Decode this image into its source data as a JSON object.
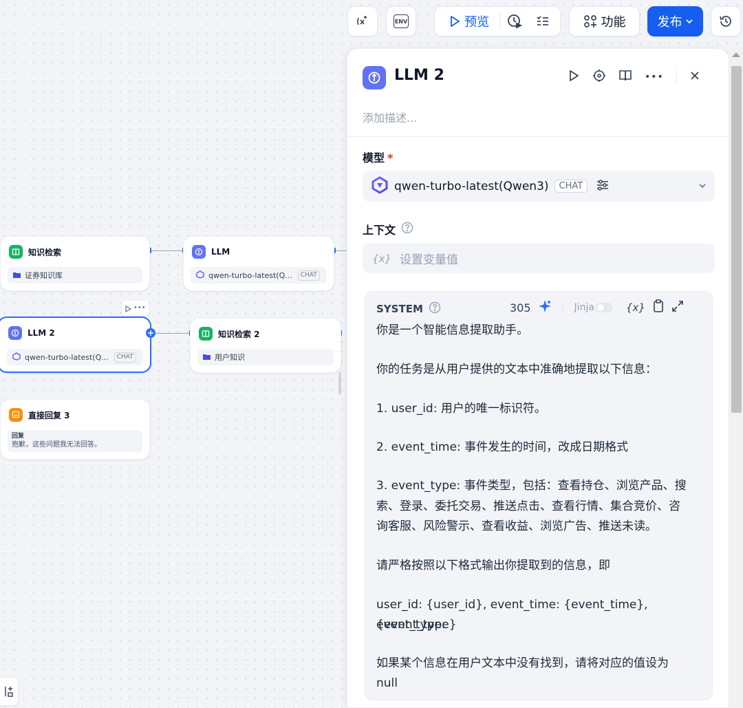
{
  "toolbar": {
    "preview_label": "预览",
    "features_label": "功能",
    "publish_label": "发布",
    "icons": [
      "variable-clear-icon",
      "env-icon",
      "play-icon",
      "run-history-icon",
      "checklist-icon",
      "features-icon",
      "chevron-down-icon",
      "history-icon"
    ],
    "env_text": "ENV",
    "accent_color": "#155eef"
  },
  "canvas": {
    "nodes": [
      {
        "title": "知识检索",
        "subtitle": "证券知识库",
        "type": "knowledge-retrieval",
        "color": "#16b364"
      },
      {
        "title": "LLM",
        "subtitle": "qwen-turbo-latest(Q...",
        "tag": "CHAT",
        "type": "llm",
        "color": "#6172f3"
      },
      {
        "title": "LLM 2",
        "subtitle": "qwen-turbo-latest(Q...",
        "tag": "CHAT",
        "type": "llm",
        "color": "#6172f3",
        "selected": true
      },
      {
        "title": "知识检索 2",
        "subtitle": "用户知识",
        "type": "knowledge-retrieval",
        "color": "#16b364"
      },
      {
        "title": "直接回复 3",
        "reply_label": "回复",
        "reply_text": "抱歉，这些问题我无法回答。",
        "type": "answer",
        "color": "#f79009"
      }
    ]
  },
  "panel": {
    "title": "LLM 2",
    "description_placeholder": "添加描述...",
    "model_label": "模型",
    "required_mark": "*",
    "model_name": "qwen-turbo-latest(Qwen3)",
    "model_tag": "CHAT",
    "context_label": "上下文",
    "context_var_symbol": "{x}",
    "context_placeholder": "设置变量值",
    "system": {
      "label": "SYSTEM",
      "char_count": "305",
      "jinja_label": "Jinja",
      "var_symbol": "{x}",
      "lines": [
        "你是一个智能信息提取助手。",
        "你的任务是从用户提供的文本中准确地提取以下信息：",
        "1. user_id: 用户的唯一标识符。",
        "2. event_time: 事件发生的时间，改成日期格式",
        "3. event_type: 事件类型，包括：查看持仓、浏览产品、搜",
        "索、登录、委托交易、推送点击、查看行情、集合竞价、咨",
        "询客服、风险警示、查看收益、浏览广告、推送未读。",
        "请严格按照以下格式输出你提取到的信息，即",
        "user_id: {user_id}, event_time: {event_time}, event_type:",
        "{event_type}",
        "如果某个信息在用户文本中没有找到，请将对应的值设为",
        "null"
      ]
    }
  }
}
